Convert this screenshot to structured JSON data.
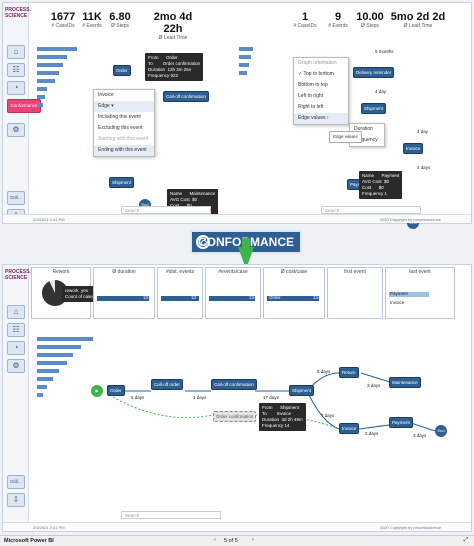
{
  "top": {
    "brand_line1": "PROCESS.",
    "brand_line2": "SCIENCE",
    "kpis_left": [
      {
        "value": "1677",
        "label": "# CaseIDs"
      },
      {
        "value": "11K",
        "label": "# Events"
      },
      {
        "value": "6.80",
        "label": "Ø Steps"
      },
      {
        "value": "2mo 4d 22h",
        "label": "Ø Lead Time"
      }
    ],
    "kpis_right": [
      {
        "value": "1",
        "label": "# CaseIDs"
      },
      {
        "value": "9",
        "label": "# Events"
      },
      {
        "value": "10.00",
        "label": "Ø Steps"
      },
      {
        "value": "5mo 2d 2d",
        "label": "Ø Lead Time"
      }
    ],
    "conformance_btn": "Conformance",
    "drill_btn": "Drill...",
    "invoice_label": "Invoice",
    "edge_dropdown": "Edge",
    "edge_menu": [
      "Including this event",
      "Excluding this event",
      "Starting with this event",
      "Ending with this event"
    ],
    "orient_menu": [
      "Graph orientation",
      "Top to bottom",
      "Bottom to top",
      "Left to right",
      "Right to left",
      "Edge values"
    ],
    "edge_values_tooltip": "Edge values",
    "edge_sub_menu": [
      "Duration",
      "Frequency"
    ],
    "tooltip1": "From      Order\nTo        Order confirmation\nDuration  12h 3m 25s\nFrequency 922",
    "tooltip2": "Name      Maintenance\nAVG Cost  $0\nCost      $0\nFrequency 52",
    "tooltip3": "Name      Payment\nAVG Cost  $0\nCost      $0\nFrequency 1",
    "nodes": [
      "Order",
      "Call-off confirmation",
      "Delivery reminder",
      "Shipment",
      "Invoice",
      "Return",
      "Maintenance",
      "Payment",
      "End"
    ],
    "edge_labels": [
      "5 months",
      "4 day",
      "4 day",
      "4 days",
      "2 days"
    ],
    "search_placeholder": "Search",
    "footer_left": "2/3/2021 2:41 PM",
    "footer_right": "2020 Copyright by processscience"
  },
  "banner": {
    "text": "CONFORMANCE"
  },
  "bottom": {
    "cards": [
      {
        "title": "Rework",
        "values": []
      },
      {
        "title": "Ø duration",
        "values": [
          "13"
        ]
      },
      {
        "title": "#dist. events",
        "values": [
          "13"
        ]
      },
      {
        "title": "#events/case",
        "values": [
          "13"
        ]
      },
      {
        "title": "Ø cost/case",
        "values": [
          "Order",
          "14"
        ]
      },
      {
        "title": "first event",
        "values": []
      },
      {
        "title": "last event",
        "values": [
          "Payment",
          "Invoice"
        ]
      }
    ],
    "rework_tooltip": "rework  yes\nCount of case_id  13 (92.86%)",
    "rework_pie_fraction": 0.9286,
    "nodes": [
      "Order",
      "Call-off order",
      "Call-off confirmation",
      "Shipment",
      "Return",
      "Maintenance",
      "Invoice",
      "Payment",
      "End",
      "Order confirmation"
    ],
    "edge_labels": [
      "5 days",
      "1 days",
      "17 days",
      "8 days",
      "3 days",
      "2 days",
      "3 days",
      "7 days"
    ],
    "tooltip": "From      Shipment\nTo        Invoice\nDuration  3d 2h 49m\nFrequency 14",
    "search_placeholder": "Search",
    "footer_left": "2/3/2021 2:41 PM",
    "footer_right": "2020 Copyright by processscience"
  },
  "powerbi": {
    "app_name": "Microsoft Power BI",
    "page_indicator": "5 of 5"
  },
  "colors": {
    "accent": "#2d5f93",
    "conformance": "#e8457a",
    "arrow": "#3db54a"
  }
}
